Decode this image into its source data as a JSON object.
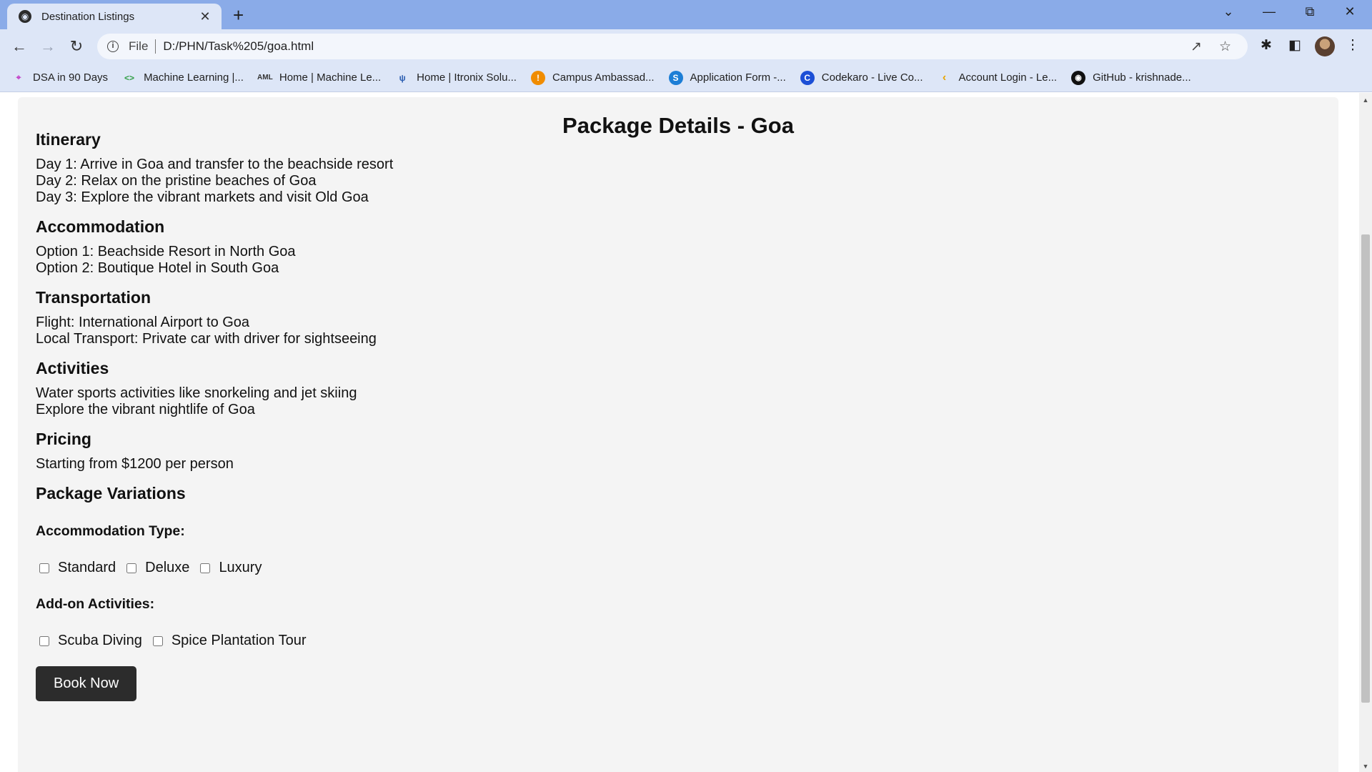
{
  "browser": {
    "tab_title": "Destination Listings",
    "url_scheme": "File",
    "url": "D:/PHN/Task%205/goa.html",
    "bookmarks": [
      {
        "label": "DSA in 90 Days",
        "icon": "dsa-icon",
        "color": "#c33cc7"
      },
      {
        "label": "Machine Learning  |...",
        "icon": "ml-code-icon",
        "color": "#2f9e44"
      },
      {
        "label": "Home | Machine Le...",
        "icon": "aiml-icon",
        "color": "#333333"
      },
      {
        "label": "Home | Itronix Solu...",
        "icon": "itronix-icon",
        "color": "#2a5db0"
      },
      {
        "label": "Campus Ambassad...",
        "icon": "campus-icon",
        "color": "#f08c00"
      },
      {
        "label": "Application Form -...",
        "icon": "skype-icon",
        "color": "#1c7ed6"
      },
      {
        "label": "Codekaro - Live Co...",
        "icon": "codekaro-icon",
        "color": "#1c4fd6"
      },
      {
        "label": "Account Login - Le...",
        "icon": "leetcode-icon",
        "color": "#e8a400"
      },
      {
        "label": "GitHub - krishnade...",
        "icon": "github-icon",
        "color": "#111111"
      }
    ]
  },
  "page": {
    "title": "Package Details - Goa",
    "sections": {
      "itinerary": {
        "heading": "Itinerary",
        "lines": [
          "Day 1: Arrive in Goa and transfer to the beachside resort",
          "Day 2: Relax on the pristine beaches of Goa",
          "Day 3: Explore the vibrant markets and visit Old Goa"
        ]
      },
      "accommodation": {
        "heading": "Accommodation",
        "lines": [
          "Option 1: Beachside Resort in North Goa",
          "Option 2: Boutique Hotel in South Goa"
        ]
      },
      "transportation": {
        "heading": "Transportation",
        "lines": [
          "Flight: International Airport to Goa",
          "Local Transport: Private car with driver for sightseeing"
        ]
      },
      "activities": {
        "heading": "Activities",
        "lines": [
          "Water sports activities like snorkeling and jet skiing",
          "Explore the vibrant nightlife of Goa"
        ]
      },
      "pricing": {
        "heading": "Pricing",
        "lines": [
          "Starting from $1200 per person"
        ]
      }
    },
    "variations": {
      "heading": "Package Variations",
      "accommodation_type_label": "Accommodation Type:",
      "accommodation_options": [
        "Standard",
        "Deluxe",
        "Luxury"
      ],
      "addon_label": "Add-on Activities:",
      "addon_options": [
        "Scuba Diving",
        "Spice Plantation Tour"
      ]
    },
    "book_button": "Book Now"
  }
}
